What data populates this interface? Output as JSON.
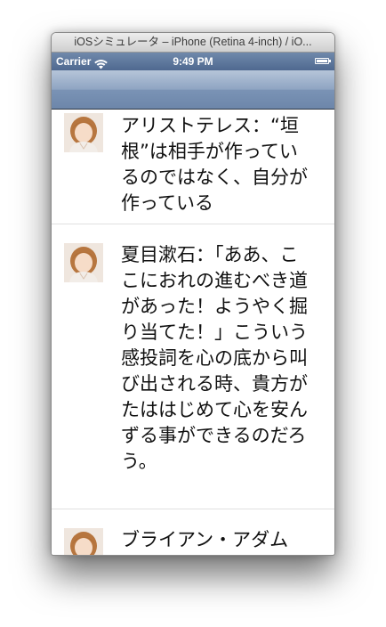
{
  "window": {
    "title": "iOSシミュレータ – iPhone (Retina 4-inch) / iO..."
  },
  "status_bar": {
    "carrier": "Carrier",
    "time": "9:49 PM",
    "icons": [
      "wifi-icon",
      "battery-icon"
    ]
  },
  "navigation_bar": {
    "title": ""
  },
  "quotes": [
    {
      "text": "アリストテレス：“垣根”は相手が作っているのではなく、自分が作っている"
    },
    {
      "text": "夏目漱石：「ああ、ここにおれの進むべき道があった！ようやく掘り当てた！」こういう感投詞を心の底から叫び出される時、貴方がたははじめて心を安んずる事ができるのだろう。"
    },
    {
      "text": "ブライアン・アダムス：貴方の周りを安"
    }
  ],
  "colors": {
    "status_bar": "#5a7399",
    "nav_bar": "#8ea4c2",
    "separator": "#e0e0e0",
    "text": "#111111"
  }
}
